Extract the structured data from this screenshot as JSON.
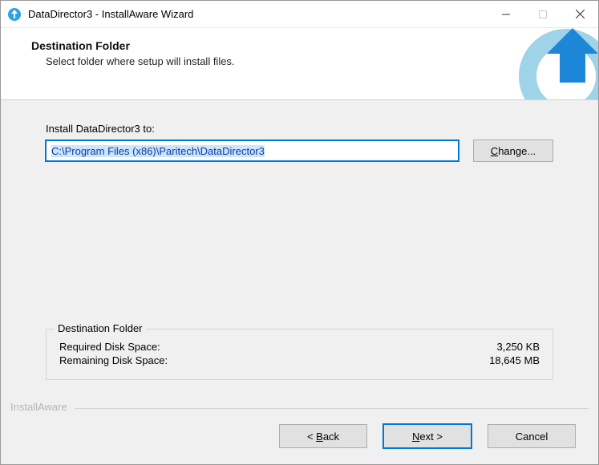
{
  "titlebar": {
    "title": "DataDirector3 - InstallAware Wizard"
  },
  "header": {
    "title": "Destination Folder",
    "subtitle": "Select folder where setup will install files."
  },
  "content": {
    "install_to_label": "Install DataDirector3 to:",
    "install_path": "C:\\Program Files (x86)\\Paritech\\DataDirector3",
    "change_button": "Change..."
  },
  "groupbox": {
    "title": "Destination Folder",
    "required_label": "Required Disk Space:",
    "required_value": "3,250 KB",
    "remaining_label": "Remaining Disk Space:",
    "remaining_value": "18,645 MB"
  },
  "branding": {
    "text": "InstallAware"
  },
  "footer": {
    "back": "< Back",
    "next": "Next >",
    "cancel": "Cancel"
  }
}
